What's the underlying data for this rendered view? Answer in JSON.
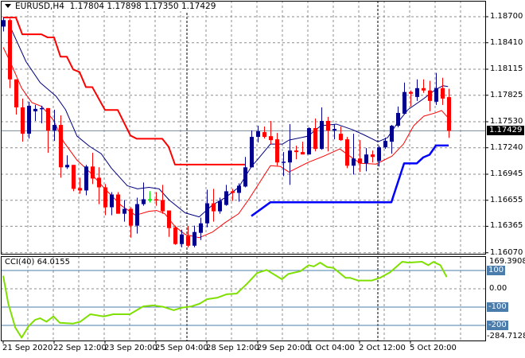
{
  "header": {
    "symbol": "EURUSD,H4",
    "open": "1.17804",
    "high": "1.17898",
    "low": "1.17350",
    "close": "1.17429"
  },
  "price_axis": [
    "1.18700",
    "1.18410",
    "1.18115",
    "1.17825",
    "1.17530",
    "1.17240",
    "1.16945",
    "1.16655",
    "1.16365",
    "1.16070"
  ],
  "last_price": "1.17429",
  "cci": {
    "label": "CCI(40) 64.0155",
    "max_label": "169.3908",
    "min_label": "-284.7128",
    "levels": [
      "100",
      "0.00",
      "-100",
      "-200"
    ]
  },
  "time_axis": [
    "21 Sep 2020",
    "22 Sep 12:00",
    "23 Sep 20:00",
    "25 Sep 04:00",
    "28 Sep 12:00",
    "29 Sep 20:00",
    "1 Oct 04:00",
    "2 Oct 12:00",
    "5 Oct 20:00"
  ],
  "colors": {
    "bull": "#00008c",
    "bear": "#ff0000",
    "doji": "#00e000",
    "upper_band": "#ff0000",
    "lower_band": "#0000ff",
    "ma_slow": "#000080",
    "ma_fast": "#ff0000",
    "cci_line": "#7fe000",
    "level": "#4a7cac",
    "grid": "#8c8c8c"
  },
  "chart_data": {
    "type": "candlestick",
    "symbol": "EURUSD",
    "timeframe": "H4",
    "ylim": [
      1.1607,
      1.187
    ],
    "candles_ohlc": [
      [
        1.1859,
        1.18688,
        1.18536,
        1.18662
      ],
      [
        1.18662,
        1.18679,
        1.17904,
        1.18002
      ],
      [
        1.18002,
        1.18002,
        1.1761,
        1.1769
      ],
      [
        1.1769,
        1.17788,
        1.17307,
        1.17396
      ],
      [
        1.17396,
        1.17753,
        1.17343,
        1.17708
      ],
      [
        1.17646,
        1.17717,
        1.17539,
        1.17673
      ],
      [
        1.17673,
        1.17708,
        1.17512,
        1.17682
      ],
      [
        1.17682,
        1.17682,
        1.17183,
        1.17432
      ],
      [
        1.17432,
        1.17664,
        1.17316,
        1.17494
      ],
      [
        1.17494,
        1.17601,
        1.16906,
        1.17022
      ],
      [
        1.17022,
        1.17156,
        1.17004,
        1.17049
      ],
      [
        1.17049,
        1.17049,
        1.16755,
        1.16782
      ],
      [
        1.16791,
        1.16906,
        1.16728,
        1.16764
      ],
      [
        1.16764,
        1.17049,
        1.1671,
        1.17031
      ],
      [
        1.17031,
        1.17183,
        1.16835,
        1.16897
      ],
      [
        1.16906,
        1.17022,
        1.16612,
        1.16799
      ],
      [
        1.16799,
        1.16835,
        1.16488,
        1.16577
      ],
      [
        1.16577,
        1.16746,
        1.16488,
        1.16719
      ],
      [
        1.16719,
        1.16746,
        1.16505,
        1.16505
      ],
      [
        1.16505,
        1.16657,
        1.16416,
        1.16559
      ],
      [
        1.16559,
        1.16577,
        1.16238,
        1.16372
      ],
      [
        1.16372,
        1.16684,
        1.16283,
        1.16612
      ],
      [
        1.16612,
        1.16853,
        1.16594,
        1.16666
      ],
      [
        1.16666,
        1.16755,
        1.1663,
        1.16666
      ],
      [
        1.16666,
        1.16746,
        1.16594,
        1.1666
      ],
      [
        1.16657,
        1.16826,
        1.16505,
        1.16532
      ],
      [
        1.16541,
        1.16541,
        1.16247,
        1.16345
      ],
      [
        1.16354,
        1.16372,
        1.16158,
        1.16167
      ],
      [
        1.16167,
        1.16327,
        1.16131,
        1.16274
      ],
      [
        1.16256,
        1.16363,
        1.16131,
        1.16149
      ],
      [
        1.16149,
        1.16372,
        1.16131,
        1.16301
      ],
      [
        1.16292,
        1.16461,
        1.16211,
        1.16398
      ],
      [
        1.16398,
        1.16773,
        1.16354,
        1.16621
      ],
      [
        1.16621,
        1.16782,
        1.16416,
        1.16532
      ],
      [
        1.16532,
        1.16684,
        1.16505,
        1.16648
      ],
      [
        1.16603,
        1.16826,
        1.16594,
        1.16755
      ],
      [
        1.16755,
        1.16782,
        1.16648,
        1.16737
      ],
      [
        1.16737,
        1.16844,
        1.16639,
        1.16817
      ],
      [
        1.16808,
        1.17138,
        1.16799,
        1.17022
      ],
      [
        1.17022,
        1.17432,
        1.17022,
        1.17361
      ],
      [
        1.17361,
        1.17485,
        1.17298,
        1.17423
      ],
      [
        1.17414,
        1.17477,
        1.17343,
        1.17361
      ],
      [
        1.17369,
        1.17539,
        1.17281,
        1.17325
      ],
      [
        1.17334,
        1.17405,
        1.1704,
        1.17076
      ],
      [
        1.17076,
        1.17192,
        1.16924,
        1.17085
      ],
      [
        1.17076,
        1.17503,
        1.16826,
        1.17209
      ],
      [
        1.17209,
        1.17263,
        1.17111,
        1.17192
      ],
      [
        1.17192,
        1.17307,
        1.17165,
        1.17165
      ],
      [
        1.17165,
        1.17468,
        1.17165,
        1.17459
      ],
      [
        1.17459,
        1.17566,
        1.172,
        1.17227
      ],
      [
        1.17227,
        1.1769,
        1.17218,
        1.17539
      ],
      [
        1.17539,
        1.17584,
        1.172,
        1.17432
      ],
      [
        1.17432,
        1.17503,
        1.17334,
        1.1745
      ],
      [
        1.17396,
        1.17477,
        1.17316,
        1.17325
      ],
      [
        1.17334,
        1.17361,
        1.17013,
        1.1704
      ],
      [
        1.1704,
        1.17396,
        1.16942,
        1.1712
      ],
      [
        1.1712,
        1.17325,
        1.16969,
        1.17067
      ],
      [
        1.17067,
        1.17236,
        1.16978,
        1.17165
      ],
      [
        1.17165,
        1.17209,
        1.17076,
        1.17138
      ],
      [
        1.17094,
        1.17263,
        1.17031,
        1.17245
      ],
      [
        1.17245,
        1.17352,
        1.17227,
        1.17316
      ],
      [
        1.17307,
        1.17494,
        1.17174,
        1.17485
      ],
      [
        1.17485,
        1.17699,
        1.17468,
        1.17628
      ],
      [
        1.17619,
        1.17967,
        1.1761,
        1.17861
      ],
      [
        1.17861,
        1.17878,
        1.17699,
        1.17842
      ],
      [
        1.17806,
        1.18002,
        1.17762,
        1.17904
      ],
      [
        1.17904,
        1.18002,
        1.17851,
        1.17878
      ],
      [
        1.17878,
        1.17985,
        1.17646,
        1.17762
      ],
      [
        1.17753,
        1.18074,
        1.17717,
        1.17904
      ],
      [
        1.17904,
        1.1802,
        1.17717,
        1.17788
      ],
      [
        1.17804,
        1.17898,
        1.1735,
        1.17429
      ]
    ],
    "upper_band": [
      [
        0,
        1.18691
      ],
      [
        2,
        1.18691
      ],
      [
        3,
        1.18504
      ],
      [
        6,
        1.18504
      ],
      [
        7,
        1.18469
      ],
      [
        8,
        1.18469
      ],
      [
        9,
        1.18255
      ],
      [
        10,
        1.18255
      ],
      [
        11,
        1.18112
      ],
      [
        12,
        1.18083
      ],
      [
        13,
        1.17916
      ],
      [
        14,
        1.17916
      ],
      [
        16,
        1.17661
      ],
      [
        18,
        1.17661
      ],
      [
        20,
        1.17376
      ],
      [
        21,
        1.1734
      ],
      [
        25,
        1.1734
      ],
      [
        26,
        1.17251
      ],
      [
        27,
        1.17052
      ],
      [
        38,
        1.17052
      ]
    ],
    "lower_band": [
      [
        39,
        1.16479
      ],
      [
        42,
        1.16633
      ],
      [
        61,
        1.16633
      ],
      [
        63,
        1.17066
      ],
      [
        65,
        1.17066
      ],
      [
        66,
        1.17132
      ],
      [
        67,
        1.17162
      ],
      [
        68,
        1.17265
      ],
      [
        70,
        1.17265
      ]
    ],
    "ma_slow": [
      [
        0.8,
        1.18635
      ],
      [
        3.6,
        1.18198
      ],
      [
        5.8,
        1.17967
      ],
      [
        8.3,
        1.17815
      ],
      [
        9.8,
        1.17664
      ],
      [
        11.6,
        1.1737
      ],
      [
        13.6,
        1.17254
      ],
      [
        15.4,
        1.17174
      ],
      [
        17,
        1.17013
      ],
      [
        19.5,
        1.16817
      ],
      [
        21.1,
        1.16782
      ],
      [
        22.9,
        1.16799
      ],
      [
        24.5,
        1.16782
      ],
      [
        26.1,
        1.16657
      ],
      [
        28.6,
        1.16514
      ],
      [
        30.8,
        1.1647
      ],
      [
        32.9,
        1.16603
      ],
      [
        34.9,
        1.16684
      ],
      [
        37,
        1.16799
      ],
      [
        39.1,
        1.1704
      ],
      [
        39.9,
        1.17102
      ],
      [
        42,
        1.17281
      ],
      [
        43.9,
        1.17281
      ],
      [
        44.9,
        1.17325
      ],
      [
        47.9,
        1.17369
      ],
      [
        49.9,
        1.17485
      ],
      [
        52.4,
        1.17503
      ],
      [
        54.9,
        1.17441
      ],
      [
        56.6,
        1.17387
      ],
      [
        58.9,
        1.17307
      ],
      [
        60.4,
        1.17352
      ],
      [
        62,
        1.17521
      ],
      [
        63.6,
        1.17664
      ],
      [
        66.1,
        1.17788
      ],
      [
        67.9,
        1.17886
      ],
      [
        69.1,
        1.17931
      ],
      [
        69.9,
        1.17922
      ]
    ],
    "ma_fast": [
      [
        0,
        1.18359
      ],
      [
        1.1,
        1.18198
      ],
      [
        2.9,
        1.17904
      ],
      [
        4.5,
        1.17744
      ],
      [
        6.1,
        1.17699
      ],
      [
        7.9,
        1.17548
      ],
      [
        9.5,
        1.17307
      ],
      [
        11.6,
        1.17102
      ],
      [
        13.6,
        1.16969
      ],
      [
        16.1,
        1.16773
      ],
      [
        18.6,
        1.16594
      ],
      [
        20.8,
        1.16488
      ],
      [
        22.9,
        1.16532
      ],
      [
        24.1,
        1.16541
      ],
      [
        25.4,
        1.16505
      ],
      [
        27,
        1.16363
      ],
      [
        28.6,
        1.16274
      ],
      [
        30.8,
        1.16238
      ],
      [
        32.9,
        1.16301
      ],
      [
        34.9,
        1.16407
      ],
      [
        37,
        1.16505
      ],
      [
        38.6,
        1.16666
      ],
      [
        42,
        1.1704
      ],
      [
        43.6,
        1.17031
      ],
      [
        44.9,
        1.16969
      ],
      [
        47.9,
        1.17076
      ],
      [
        50.4,
        1.17147
      ],
      [
        52.9,
        1.17227
      ],
      [
        54.1,
        1.17165
      ],
      [
        56.1,
        1.17067
      ],
      [
        58.6,
        1.17058
      ],
      [
        61.1,
        1.17147
      ],
      [
        62.9,
        1.17281
      ],
      [
        64.5,
        1.17485
      ],
      [
        66.1,
        1.17592
      ],
      [
        67.9,
        1.17628
      ],
      [
        68.9,
        1.17655
      ],
      [
        69.9,
        1.17575
      ]
    ],
    "cci": {
      "period": 40,
      "ylim": [
        -284.7128,
        169.3908
      ],
      "levels": [
        100,
        0,
        -100,
        -200
      ],
      "points": [
        [
          0,
          71
        ],
        [
          0.8,
          -81
        ],
        [
          1.9,
          -212
        ],
        [
          2.9,
          -267
        ],
        [
          4,
          -204
        ],
        [
          5,
          -170
        ],
        [
          5.8,
          -161
        ],
        [
          6.8,
          -180
        ],
        [
          7.9,
          -151
        ],
        [
          8.9,
          -186
        ],
        [
          11,
          -190
        ],
        [
          12.1,
          -180
        ],
        [
          13.7,
          -139
        ],
        [
          15.8,
          -151
        ],
        [
          17.3,
          -139
        ],
        [
          19.9,
          -139
        ],
        [
          22,
          -96
        ],
        [
          23.6,
          -91
        ],
        [
          25.2,
          -99
        ],
        [
          26.8,
          -117
        ],
        [
          28.1,
          -103
        ],
        [
          29.6,
          -96
        ],
        [
          30.9,
          -81
        ],
        [
          32,
          -57
        ],
        [
          33.6,
          -49
        ],
        [
          35.1,
          -30
        ],
        [
          36.7,
          -26
        ],
        [
          38.3,
          27
        ],
        [
          39.9,
          86
        ],
        [
          41.4,
          103
        ],
        [
          43.8,
          52
        ],
        [
          44.8,
          81
        ],
        [
          46.7,
          96
        ],
        [
          48,
          129
        ],
        [
          48.8,
          122
        ],
        [
          49.8,
          143
        ],
        [
          50.9,
          119
        ],
        [
          51.9,
          114
        ],
        [
          53.8,
          60
        ],
        [
          54.5,
          60
        ],
        [
          55.8,
          45
        ],
        [
          57.9,
          45
        ],
        [
          59.2,
          60
        ],
        [
          60.8,
          90
        ],
        [
          62.7,
          148
        ],
        [
          63.7,
          143
        ],
        [
          65.8,
          148
        ],
        [
          66.8,
          129
        ],
        [
          67.6,
          147
        ],
        [
          68.7,
          129
        ],
        [
          69.7,
          64
        ]
      ]
    }
  }
}
